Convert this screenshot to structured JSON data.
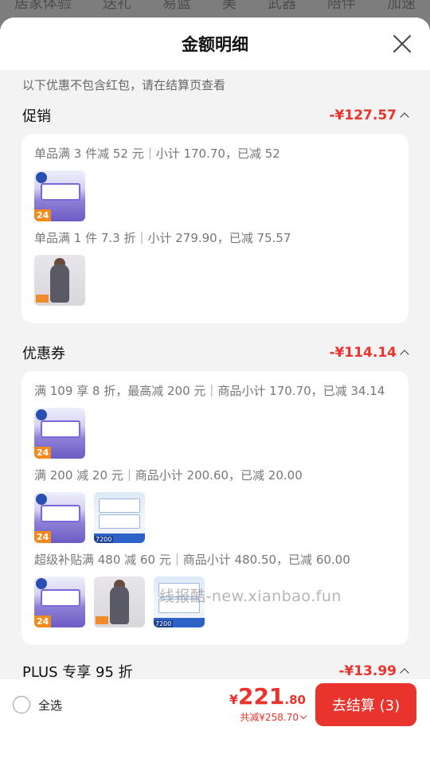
{
  "background_tabs": [
    "居家体验",
    "送礼",
    "易蓝",
    "美",
    "武器",
    "陪伴",
    "加速"
  ],
  "sheet": {
    "title": "金额明细",
    "notice": "以下优惠不包含红包，请在结算页查看"
  },
  "sections": [
    {
      "title": "促销",
      "amount": "-¥127.57",
      "groups": [
        {
          "rule": "单品满 3 件减 52 元｜小计 170.70，已减 52",
          "thumbs": [
            "tissue"
          ]
        },
        {
          "rule": "单品满 1 件 7.3 折｜小计 279.90，已减 75.57",
          "thumbs": [
            "model"
          ]
        }
      ]
    },
    {
      "title": "优惠券",
      "amount": "-¥114.14",
      "groups": [
        {
          "rule": "满 109 享 8 折，最高减 200 元｜商品小计 170.70，已减 34.14",
          "thumbs": [
            "tissue"
          ]
        },
        {
          "rule": "满 200 减 20 元｜商品小计 200.60，已减 20.00",
          "thumbs": [
            "tissue",
            "pack"
          ]
        },
        {
          "rule": "超级补贴满 480 减 60 元｜商品小计 480.50，已减 60.00",
          "thumbs": [
            "tissue",
            "model",
            "pack"
          ]
        }
      ]
    },
    {
      "title": "PLUS 专享 95 折",
      "amount": "-¥13.99"
    }
  ],
  "thumb_badges": {
    "tissue": "24",
    "pack": "7200"
  },
  "watermark": "线报酷-new.xianbao.fun",
  "footer": {
    "select_all": "全选",
    "price_currency": "¥",
    "price_integer": "221",
    "price_decimal": ".80",
    "saving": "共减¥258.70",
    "checkout": "去结算 (3)"
  },
  "colors": {
    "accent": "#e8342c"
  }
}
